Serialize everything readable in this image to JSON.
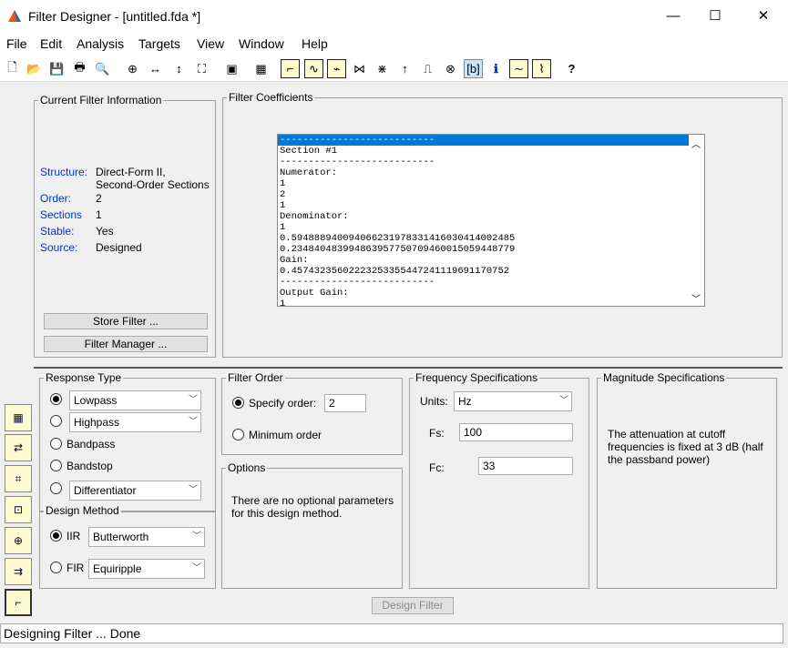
{
  "window": {
    "title": "Filter Designer -  [untitled.fda *]",
    "minimize": "—",
    "maximize": "☐",
    "close": "✕"
  },
  "menu": [
    "File",
    "Edit",
    "Analysis",
    "Targets",
    "View",
    "Window",
    "Help"
  ],
  "toolbar_icons": [
    "new-icon",
    "open-icon",
    "save-icon",
    "print-icon",
    "print-preview-icon",
    "zoom-in-icon",
    "zoom-x-icon",
    "zoom-y-icon",
    "full-view-icon",
    "new-figure-icon",
    "filter-manager-icon",
    "magnitude-response-icon",
    "phase-response-icon",
    "mag-phase-icon",
    "group-delay-icon",
    "phase-delay-icon",
    "impulse-response-icon",
    "step-response-icon",
    "pole-zero-icon",
    "filter-coefficients-icon",
    "filter-info-icon",
    "magnitude-estimate-icon",
    "noise-psd-icon",
    "whats-this-icon"
  ],
  "current_filter": {
    "legend": "Current Filter Information",
    "rows": [
      {
        "label": "Structure:",
        "value": "Direct-Form II,"
      },
      {
        "label": "",
        "value": "Second-Order Sections"
      },
      {
        "label": "Order:",
        "value": "2"
      },
      {
        "label": "Sections",
        "value": "1"
      },
      {
        "label": "Stable:",
        "value": "Yes"
      },
      {
        "label": "Source:",
        "value": "Designed"
      }
    ],
    "store_button": "Store Filter ...",
    "manager_button": "Filter Manager ..."
  },
  "coefficients": {
    "legend": "Filter Coefficients",
    "lines": [
      "---------------------------",
      "Section #1",
      "---------------------------",
      "Numerator:",
      "1",
      "2",
      "1",
      "Denominator:",
      "1",
      "0.5948889400940662319783314160304140024​85",
      "0.2348404839948639577507094600150594487​79",
      "Gain:",
      "0.4574323560222325335544724111969117075​2",
      "---------------------------",
      "Output Gain:",
      "1"
    ],
    "scroll_up": "︿",
    "scroll_down": "﹀"
  },
  "response_type": {
    "legend": "Response Type",
    "options": [
      {
        "label": "Lowpass",
        "selected": true,
        "dropdown": true
      },
      {
        "label": "Highpass",
        "selected": false,
        "dropdown": true
      },
      {
        "label": "Bandpass",
        "selected": false,
        "dropdown": false
      },
      {
        "label": "Bandstop",
        "selected": false,
        "dropdown": false
      },
      {
        "label": "Differentiator",
        "selected": false,
        "dropdown": true
      }
    ]
  },
  "design_method": {
    "legend": "Design Method",
    "iir_label": "IIR",
    "iir_value": "Butterworth",
    "fir_label": "FIR",
    "fir_value": "Equiripple"
  },
  "filter_order": {
    "legend": "Filter Order",
    "specify_label": "Specify order:",
    "specify_value": "2",
    "minimum_label": "Minimum order"
  },
  "options": {
    "legend": "Options",
    "text": "There are no optional parameters for this design method."
  },
  "frequency_specs": {
    "legend": "Frequency Specifications",
    "units_label": "Units:",
    "units_value": "Hz",
    "fs_label": "Fs:",
    "fs_value": "100",
    "fc_label": "Fc:",
    "fc_value": "33"
  },
  "magnitude_specs": {
    "legend": "Magnitude Specifications",
    "text": "The attenuation at cutoff frequencies is fixed at 3 dB (half the passband power)"
  },
  "design_button": "Design Filter",
  "status": "Designing Filter ... Done",
  "colors": {
    "accent": "#0078d7",
    "label_blue": "#0033cc"
  }
}
